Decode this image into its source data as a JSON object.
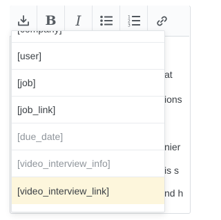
{
  "toolbar": {
    "buttons": [
      {
        "icon": "insert-placeholder-icon"
      },
      {
        "icon": "bold-icon",
        "glyph": "B"
      },
      {
        "icon": "italic-icon",
        "glyph": "I"
      },
      {
        "icon": "bulleted-list-icon"
      },
      {
        "icon": "numbered-list-icon"
      },
      {
        "icon": "link-icon"
      }
    ]
  },
  "editor": {
    "visible_text": [
      "at",
      "ions",
      "nier",
      "is s",
      "nd h"
    ]
  },
  "dropdown": {
    "items": [
      {
        "label": "[company]",
        "state": "normal"
      },
      {
        "label": "[user]",
        "state": "normal"
      },
      {
        "label": "[job]",
        "state": "normal"
      },
      {
        "label": "[job_link]",
        "state": "normal"
      },
      {
        "label": "[due_date]",
        "state": "muted"
      },
      {
        "label": "[video_interview_info]",
        "state": "muted"
      },
      {
        "label": "[video_interview_link]",
        "state": "highlighted"
      }
    ],
    "highlight_color": "#fdf6dc"
  }
}
